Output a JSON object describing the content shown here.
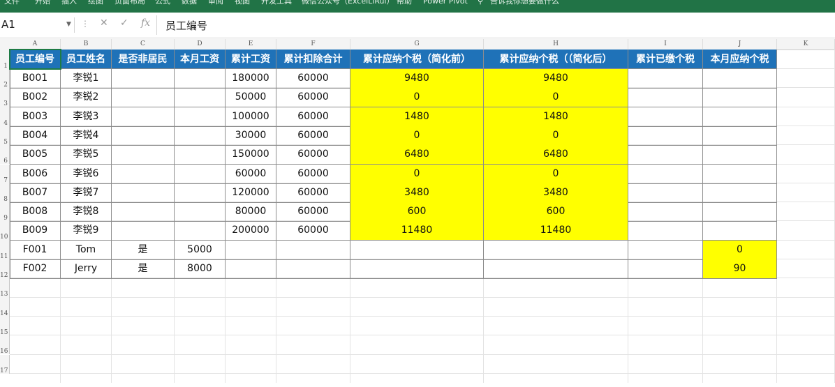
{
  "ribbon": {
    "tabs": [
      "文件",
      "开始",
      "插入",
      "绘图",
      "页面布局",
      "公式",
      "数据",
      "审阅",
      "视图",
      "开发工具",
      "微信公众号（ExcelLiRui）",
      "帮助",
      "Power Pivot"
    ],
    "tell_me": "告诉我你想要做什么"
  },
  "formula_bar": {
    "name_box": "A1",
    "cancel_symbol": "✕",
    "enter_symbol": "✓",
    "fx_symbol": "fx",
    "content": "员工编号"
  },
  "columns": [
    "A",
    "B",
    "C",
    "D",
    "E",
    "F",
    "G",
    "H",
    "I",
    "J",
    "K"
  ],
  "rows": [
    "1",
    "2",
    "3",
    "4",
    "5",
    "6",
    "7",
    "8",
    "9",
    "10",
    "11",
    "12",
    "13",
    "14",
    "15",
    "16",
    "17"
  ],
  "table": {
    "headers": [
      "员工编号",
      "员工姓名",
      "是否非居民",
      "本月工资",
      "累计工资",
      "累计扣除合计",
      "累计应纳个税（简化前）",
      "累计应纳个税（（简化后）",
      "累计已缴个税",
      "本月应纳个税"
    ],
    "rows": [
      [
        "B001",
        "李锐1",
        "",
        "",
        "180000",
        "60000",
        "9480",
        "9480",
        "",
        ""
      ],
      [
        "B002",
        "李锐2",
        "",
        "",
        "50000",
        "60000",
        "0",
        "0",
        "",
        ""
      ],
      [
        "B003",
        "李锐3",
        "",
        "",
        "100000",
        "60000",
        "1480",
        "1480",
        "",
        ""
      ],
      [
        "B004",
        "李锐4",
        "",
        "",
        "30000",
        "60000",
        "0",
        "0",
        "",
        ""
      ],
      [
        "B005",
        "李锐5",
        "",
        "",
        "150000",
        "60000",
        "6480",
        "6480",
        "",
        ""
      ],
      [
        "B006",
        "李锐6",
        "",
        "",
        "60000",
        "60000",
        "0",
        "0",
        "",
        ""
      ],
      [
        "B007",
        "李锐7",
        "",
        "",
        "120000",
        "60000",
        "3480",
        "3480",
        "",
        ""
      ],
      [
        "B008",
        "李锐8",
        "",
        "",
        "80000",
        "60000",
        "600",
        "600",
        "",
        ""
      ],
      [
        "B009",
        "李锐9",
        "",
        "",
        "200000",
        "60000",
        "11480",
        "11480",
        "",
        ""
      ],
      [
        "F001",
        "Tom",
        "是",
        "5000",
        "",
        "",
        "",
        "",
        "",
        "0"
      ],
      [
        "F002",
        "Jerry",
        "是",
        "8000",
        "",
        "",
        "",
        "",
        "",
        "90"
      ]
    ]
  },
  "colors": {
    "header_fill": "#1f72b8",
    "highlight_fill": "#ffff00",
    "ribbon": "#217346",
    "selection": "#1e7b45"
  }
}
